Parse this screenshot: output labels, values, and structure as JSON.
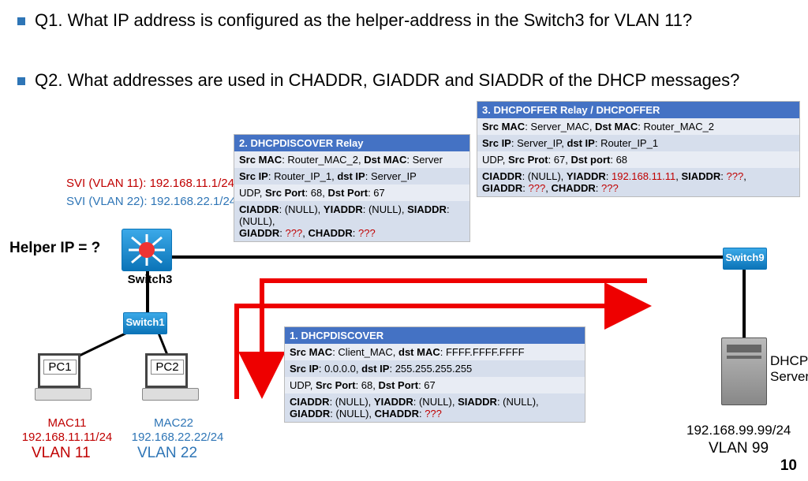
{
  "questions": {
    "q1": "Q1. What IP address is configured as the helper-address in the Switch3 for VLAN 11?",
    "q2": "Q2. What addresses are used in CHADDR, GIADDR and SIADDR of the DHCP messages?"
  },
  "svi": {
    "vlan11": "SVI (VLAN 11): 192.168.11.1/24",
    "vlan22": "SVI (VLAN 22): 192.168.22.1/24"
  },
  "helper_label": "Helper IP = ?",
  "devices": {
    "switch3": "Switch3",
    "switch1": "Switch1",
    "switch9": "Switch9",
    "pc1": "PC1",
    "pc2": "PC2",
    "dhcp_server": "DHCP Server",
    "server_ip": "192.168.99.99/24",
    "server_vlan": "VLAN 99"
  },
  "pc_info": {
    "pc1_mac": "MAC11",
    "pc1_ip": "192.168.11.11/24",
    "pc1_vlan": "VLAN 11",
    "pc2_mac": "MAC22",
    "pc2_ip": "192.168.22.22/24",
    "pc2_vlan": "VLAN 22"
  },
  "box1": {
    "title": "1. DHCPDISCOVER",
    "r1a": "Src MAC",
    "r1b": ": Client_MAC, ",
    "r1c": "dst MAC",
    "r1d": ": FFFF.FFFF.FFFF",
    "r2a": "Src IP",
    "r2b": ": 0.0.0.0, ",
    "r2c": "dst IP",
    "r2d": ": 255.255.255.255",
    "r3a": "UDP, ",
    "r3b": "Src Port",
    "r3c": ": 68, ",
    "r3d": "Dst Port",
    "r3e": ": 67",
    "r4a": "CIADDR",
    "r4b": ": (NULL), ",
    "r4c": "YIADDR",
    "r4d": ": (NULL), ",
    "r4e": "SIADDR",
    "r4f": ": (NULL),",
    "r5a": "GIADDR",
    "r5b": ": (NULL), ",
    "r5c": "CHADDR",
    "r5d": ": ",
    "r5e": "???"
  },
  "box2": {
    "title": "2. DHCPDISCOVER Relay",
    "r1a": "Src MAC",
    "r1b": ": Router_MAC_2, ",
    "r1c": "Dst MAC",
    "r1d": ": Server",
    "r2a": "Src IP",
    "r2b": ": Router_IP_1, ",
    "r2c": "dst IP",
    "r2d": ": Server_IP",
    "r3a": "UDP, ",
    "r3b": "Src Port",
    "r3c": ": 68, ",
    "r3d": "Dst Port",
    "r3e": ": 67",
    "r4a": "CIADDR",
    "r4b": ": (NULL), ",
    "r4c": "YIADDR",
    "r4d": ": (NULL), ",
    "r4e": "SIADDR",
    "r4f": ": (NULL),",
    "r5a": "GIADDR",
    "r5b": ": ",
    "r5c": "???",
    "r5d": ", ",
    "r5e": "CHADDR",
    "r5f": ": ",
    "r5g": "???"
  },
  "box3": {
    "title": "3. DHCPOFFER Relay / DHCPOFFER",
    "r1a": "Src MAC",
    "r1b": ": Server_MAC, ",
    "r1c": "Dst MAC",
    "r1d": ": Router_MAC_2",
    "r2a": "Src IP",
    "r2b": ": Server_IP, ",
    "r2c": "dst IP",
    "r2d": ": Router_IP_1",
    "r3a": "UDP, ",
    "r3b": "Src Prot",
    "r3c": ": 67, ",
    "r3d": "Dst port",
    "r3e": ": 68",
    "r4a": "CIADDR",
    "r4b": ": (NULL), ",
    "r4c": "YIADDR",
    "r4d": ": ",
    "r4e": "192.168.11.11",
    "r4f": ", ",
    "r4g": "SIADDR",
    "r4h": ": ",
    "r4i": "???",
    "r4j": ",",
    "r5a": "GIADDR",
    "r5b": ": ",
    "r5c": "???",
    "r5d": ", ",
    "r5e": "CHADDR",
    "r5f": ": ",
    "r5g": "???"
  },
  "slide_number": "10"
}
